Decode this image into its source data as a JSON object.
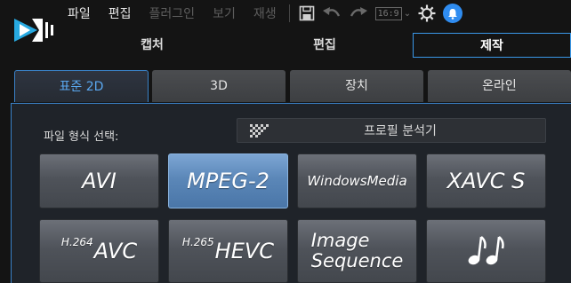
{
  "menu": {
    "items": [
      {
        "label": "파일",
        "enabled": true
      },
      {
        "label": "편집",
        "enabled": true
      },
      {
        "label": "플러그인",
        "enabled": false
      },
      {
        "label": "보기",
        "enabled": false
      },
      {
        "label": "재생",
        "enabled": false
      }
    ],
    "aspect_ratio": "16:9"
  },
  "mode_tabs": [
    {
      "label": "캡처",
      "active": false
    },
    {
      "label": "편집",
      "active": false
    },
    {
      "label": "제작",
      "active": true
    }
  ],
  "sub_tabs": [
    {
      "label": "표준 2D",
      "active": true
    },
    {
      "label": "3D",
      "active": false
    },
    {
      "label": "장치",
      "active": false
    },
    {
      "label": "온라인",
      "active": false
    }
  ],
  "panel": {
    "format_label": "파일 형식 선택:",
    "profile_analyzer_label": "프로필 분석기"
  },
  "formats": [
    {
      "label": "AVI",
      "selected": false
    },
    {
      "label": "MPEG-2",
      "selected": true
    },
    {
      "label": "WindowsMedia",
      "selected": false
    },
    {
      "label": "XAVC S",
      "selected": false
    },
    {
      "prefix": "H.264",
      "label": "AVC",
      "selected": false
    },
    {
      "prefix": "H.265",
      "label": "HEVC",
      "selected": false
    },
    {
      "line1": "Image",
      "line2": "Sequence",
      "selected": false
    },
    {
      "icon": "music-notes-icon",
      "selected": false
    }
  ],
  "colors": {
    "accent": "#3a98e8",
    "notification": "#2f8cf0",
    "selected_format": "#5b87b8"
  }
}
